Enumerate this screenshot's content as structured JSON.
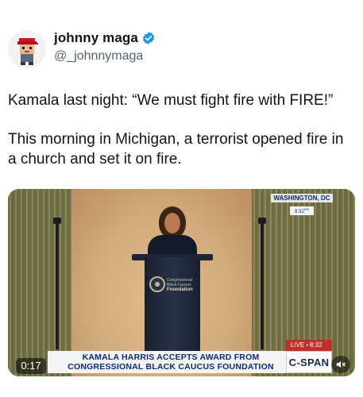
{
  "tweet": {
    "author": {
      "display_name": "johnny maga",
      "handle": "@_johnnymaga",
      "verified": true,
      "avatar_icon": "pixel-avatar-red-cap-icon"
    },
    "text_paragraphs": [
      "Kamala last night: “We must fight fire with FIRE!”",
      "This morning in Michigan, a terrorist opened fire in a church and set it on fire."
    ]
  },
  "video": {
    "location_label": "WASHINGTON, DC",
    "location_time": "8:32",
    "location_time_suffix": "PM",
    "chyron_line1": "KAMALA HARRIS ACCEPTS AWARD FROM",
    "chyron_line2": "CONGRESSIONAL BLACK CAUCUS FOUNDATION",
    "live_label": "LIVE",
    "live_time": "8:32",
    "network_logo": "C-SPAN",
    "elapsed_time": "0:17",
    "podium_sign": {
      "line1": "Congressional",
      "line2": "Black Caucus",
      "line3": "Foundation"
    },
    "mute_icon": "speaker-muted-icon"
  },
  "colors": {
    "verified_badge": "#1d9bf0",
    "chyron_text": "#0d2a6e",
    "live_red": "#c0302b",
    "avatar_cap": "#d0152a"
  }
}
